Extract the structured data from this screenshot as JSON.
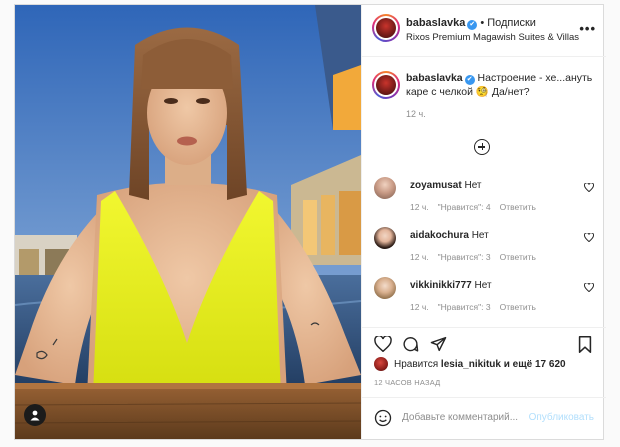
{
  "post": {
    "username": "babaslavka",
    "verified_mark": "✔",
    "separator": "•",
    "follow_label": "Подписки",
    "location": "Rixos Premium Magawish Suites & Villas",
    "more_icon": "more-horizontal-icon",
    "more_label": "•••"
  },
  "caption": {
    "username": "babaslavka",
    "text": "Настроение - хе...ануть каре с челкой 🧐 Да/нет?",
    "time": "12 ч."
  },
  "load_more_icon": "plus-circle-icon",
  "comments": [
    {
      "username": "zoyamusat",
      "text": "Нет",
      "time": "12 ч.",
      "likes": "\"Нравится\": 4",
      "reply": "Ответить"
    },
    {
      "username": "aidakochura",
      "text": "Нет",
      "time": "12 ч.",
      "likes": "\"Нравится\": 3",
      "reply": "Ответить"
    },
    {
      "username": "vikkinikki777",
      "text": "Нет",
      "time": "12 ч.",
      "likes": "\"Нравится\": 3",
      "reply": "Ответить"
    }
  ],
  "actions": {
    "like_icon": "heart-icon",
    "comment_icon": "comment-icon",
    "share_icon": "send-icon",
    "save_icon": "bookmark-icon"
  },
  "likes": {
    "prefix": "Нравится",
    "user": "lesia_nikituk",
    "suffix": "и ещё 17 620"
  },
  "post_time": "12 ЧАСОВ НАЗАД",
  "add_comment": {
    "placeholder": "Добавьте комментарий...",
    "publish_label": "Опубликовать"
  },
  "colors": {
    "link_blue": "#3897f0",
    "publish_disabled": "#b2dffc",
    "muted_text": "#8e8e8e",
    "swimsuit_yellow": "#e9f21f"
  }
}
